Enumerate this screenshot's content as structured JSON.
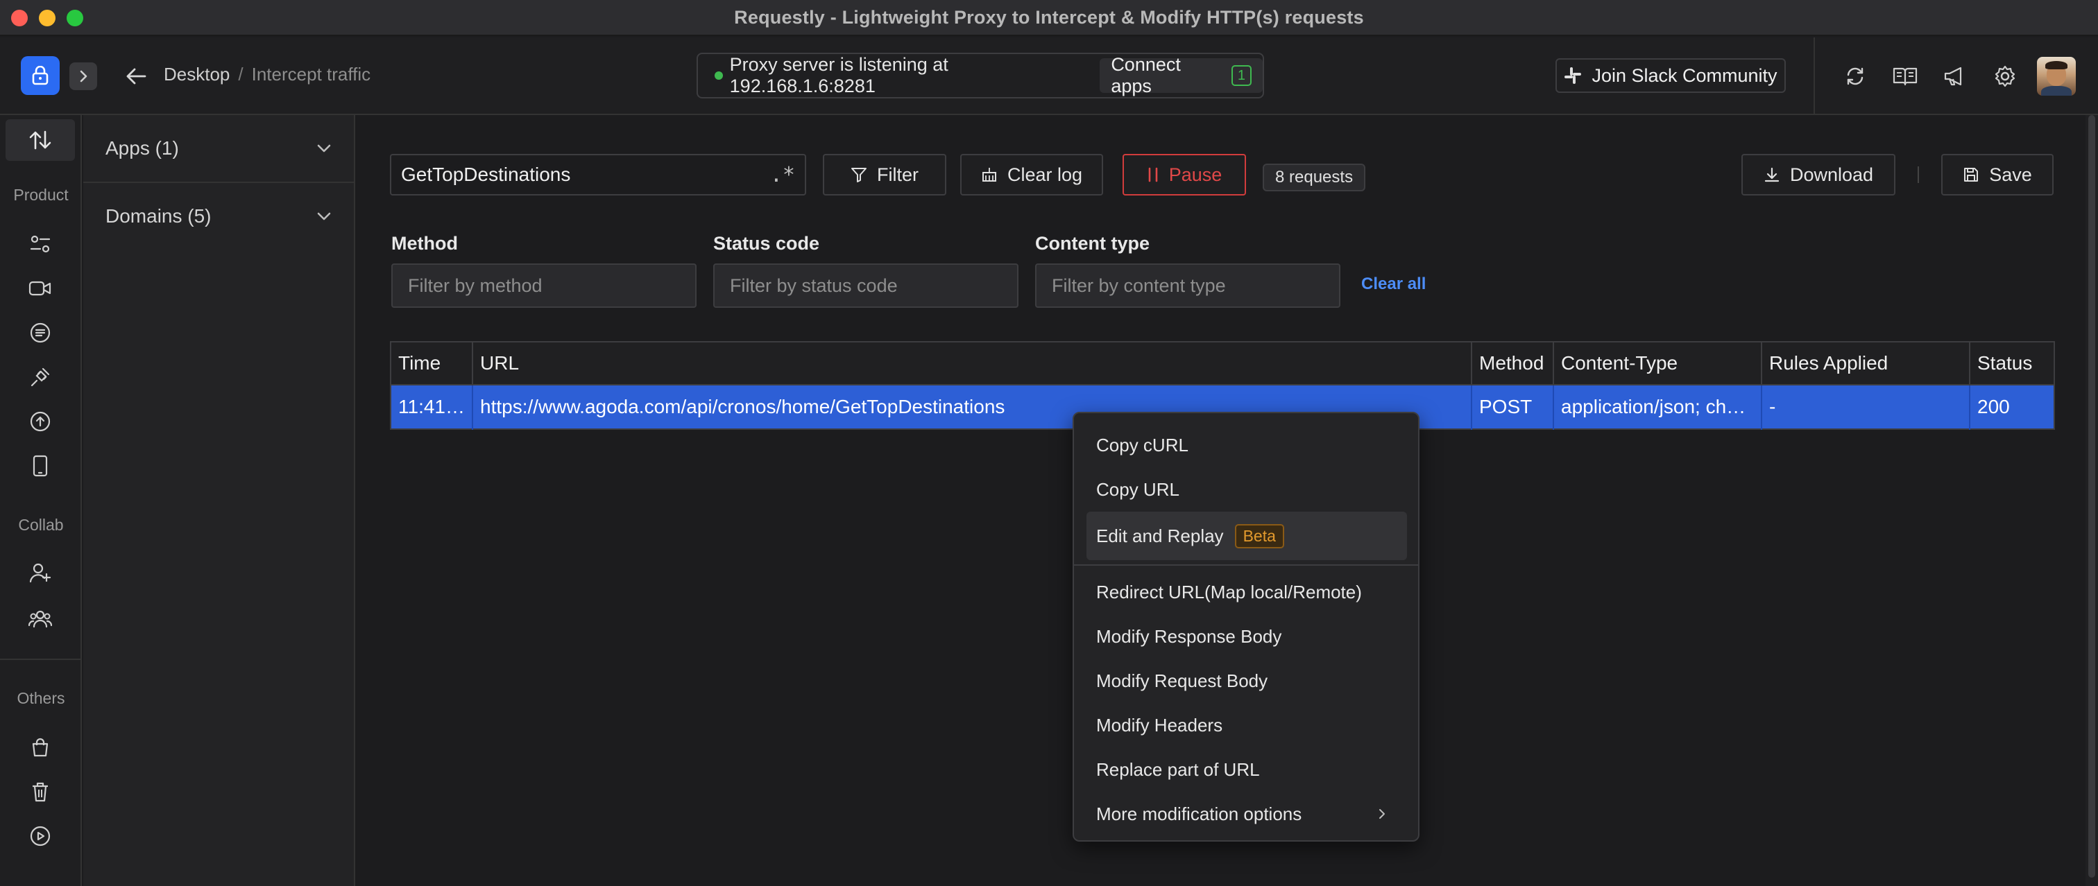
{
  "window": {
    "title": "Requestly - Lightweight Proxy to Intercept & Modify HTTP(s) requests"
  },
  "header": {
    "breadcrumb": [
      "Desktop",
      "/",
      "Intercept traffic"
    ],
    "proxy_status": "Proxy server is listening at 192.168.1.6:8281",
    "connect_apps_label": "Connect apps",
    "connect_apps_count": "1",
    "slack_label": "Join Slack Community",
    "icons": [
      "sync-icon",
      "docs-icon",
      "announcement-icon",
      "settings-icon"
    ]
  },
  "leftnav": {
    "sections": [
      "Product",
      "Collab",
      "Others"
    ]
  },
  "filters_sidebar": {
    "items": [
      "Apps (1)",
      "Domains (5)"
    ]
  },
  "toolbar": {
    "search_value": "GetTopDestinations",
    "regex_label": ".*",
    "filter_label": "Filter",
    "clear_log_label": "Clear log",
    "pause_label": "Pause",
    "request_count": "8 requests",
    "download_label": "Download",
    "save_label": "Save"
  },
  "field_filters": {
    "method_label": "Method",
    "method_placeholder": "Filter by method",
    "status_label": "Status code",
    "status_placeholder": "Filter by status code",
    "content_label": "Content type",
    "content_placeholder": "Filter by content type",
    "clear_all": "Clear all"
  },
  "table": {
    "columns": [
      "Time",
      "URL",
      "Method",
      "Content-Type",
      "Rules Applied",
      "Status"
    ],
    "rows": [
      {
        "time": "11:41…",
        "url": "https://www.agoda.com/api/cronos/home/GetTopDestinations",
        "method": "POST",
        "content_type": "application/json; ch…",
        "rules": "-",
        "status": "200"
      }
    ]
  },
  "context_menu": {
    "items": [
      "Copy cURL",
      "Copy URL",
      "Edit and Replay",
      "Redirect URL(Map local/Remote)",
      "Modify Response Body",
      "Modify Request Body",
      "Modify Headers",
      "Replace part of URL",
      "More modification options"
    ],
    "beta_label": "Beta"
  },
  "colors": {
    "accent": "#2b6bf3",
    "row_selected": "#2d5fd6",
    "pause_red": "#e04848",
    "status_green": "#3fb950",
    "beta_orange": "#e39a2d",
    "link_blue": "#4d8df7"
  }
}
